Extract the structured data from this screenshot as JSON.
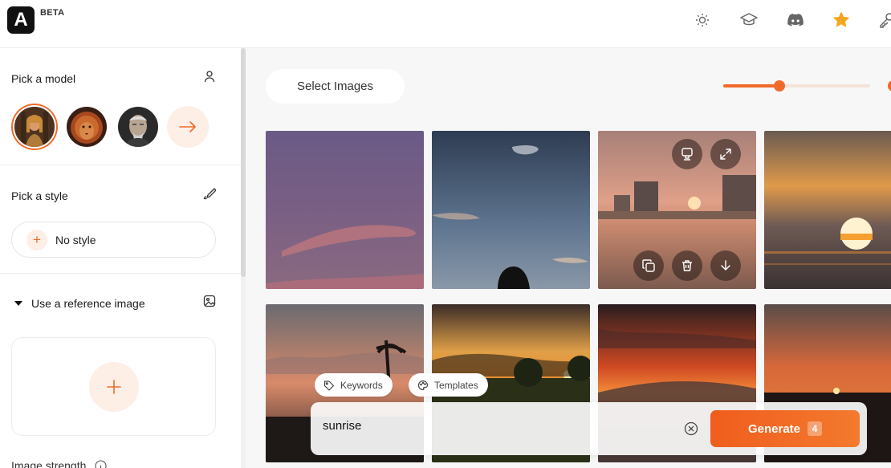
{
  "app": {
    "logo_letter": "A",
    "badge": "BETA",
    "accent_color": "#f06a2a"
  },
  "topbar": {
    "icons": [
      "sun-icon",
      "graduation-cap-icon",
      "discord-icon",
      "star-icon",
      "key-icon"
    ]
  },
  "sidebar": {
    "model_section": {
      "title": "Pick a model",
      "models": [
        "woman-portrait",
        "lion-portrait",
        "old-man-portrait"
      ],
      "selected_index": 0
    },
    "style_section": {
      "title": "Pick a style",
      "style_value": "No style"
    },
    "reference_section": {
      "title": "Use a reference image",
      "expanded": true
    },
    "strength_section": {
      "title": "Image strength"
    }
  },
  "main": {
    "select_images_label": "Select Images",
    "slider": {
      "value_fraction": 0.38
    },
    "gallery": {
      "image_count": 8,
      "hovered_tile_index": 2
    },
    "prompt": {
      "chips": [
        "Keywords",
        "Templates"
      ],
      "value": "sunrise",
      "generate_label": "Generate",
      "generate_count": "4"
    }
  }
}
